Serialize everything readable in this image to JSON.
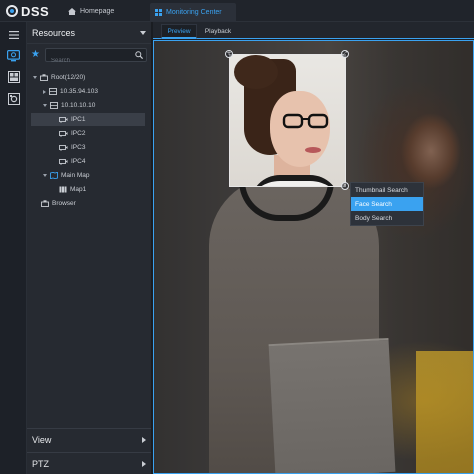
{
  "app": {
    "name": "DSS"
  },
  "topbar": {
    "home_label": "Homepage",
    "active_tab_label": "Monitoring Center"
  },
  "panel": {
    "title": "Resources",
    "search_placeholder": "Search",
    "tree": [
      {
        "label": "Root(12/20)",
        "expanded": true
      },
      {
        "label": "10.35.94.103",
        "expanded": false
      },
      {
        "label": "10.10.10.10",
        "expanded": false
      },
      {
        "label": "IPC1",
        "selected": true
      },
      {
        "label": "IPC2"
      },
      {
        "label": "IPC3"
      },
      {
        "label": "IPC4"
      },
      {
        "label": "Main Map",
        "expanded": true
      },
      {
        "label": "Map1"
      },
      {
        "label": "Browser"
      }
    ],
    "bottom_sections": [
      "View",
      "PTZ"
    ]
  },
  "subtabs": {
    "preview": "Preview",
    "playback": "Playback"
  },
  "context_menu": {
    "items": [
      "Thumbnail Search",
      "Face Search",
      "Body Search"
    ],
    "highlighted": "Face Search"
  },
  "colors": {
    "accent": "#3aa2f0",
    "panel_bg": "#262a31",
    "topbar_bg": "#20242b"
  }
}
